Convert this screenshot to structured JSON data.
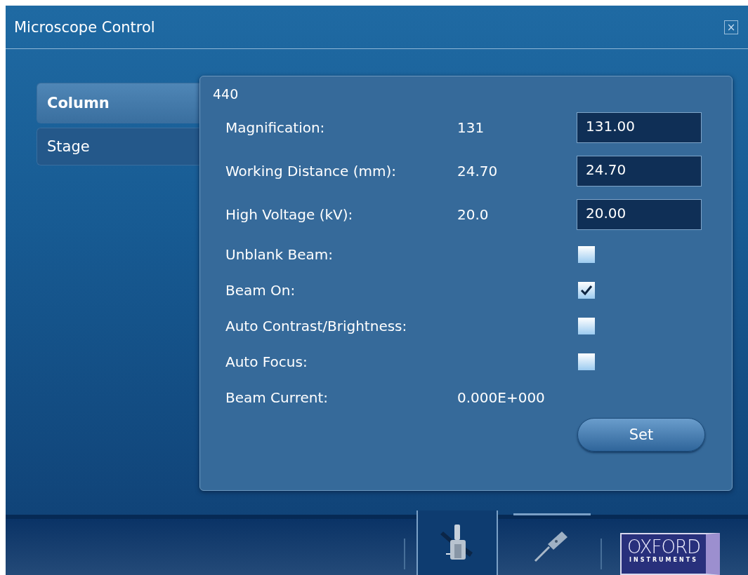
{
  "window": {
    "title": "Microscope Control",
    "close": "×"
  },
  "tabs": [
    {
      "label": "Column",
      "selected": true
    },
    {
      "label": "Stage",
      "selected": false
    }
  ],
  "panel": {
    "heading": "440",
    "rows": [
      {
        "kind": "field",
        "label": "Magnification:",
        "reading": "131",
        "value": "131.00"
      },
      {
        "kind": "field",
        "label": "Working Distance (mm):",
        "reading": "24.70",
        "value": "24.70"
      },
      {
        "kind": "field",
        "label": "High Voltage (kV):",
        "reading": "20.0",
        "value": "20.00"
      },
      {
        "kind": "checkbox",
        "label": "Unblank Beam:",
        "checked": false
      },
      {
        "kind": "checkbox",
        "label": "Beam On:",
        "checked": true
      },
      {
        "kind": "checkbox",
        "label": "Auto Contrast/Brightness:",
        "checked": false
      },
      {
        "kind": "checkbox",
        "label": "Auto Focus:",
        "checked": false
      },
      {
        "kind": "reading",
        "label": "Beam Current:",
        "reading": "0.000E+000"
      }
    ],
    "button": "Set"
  },
  "bottom_bar": {
    "logo": {
      "name": "OXFORD",
      "sub": "INSTRUMENTS"
    }
  }
}
